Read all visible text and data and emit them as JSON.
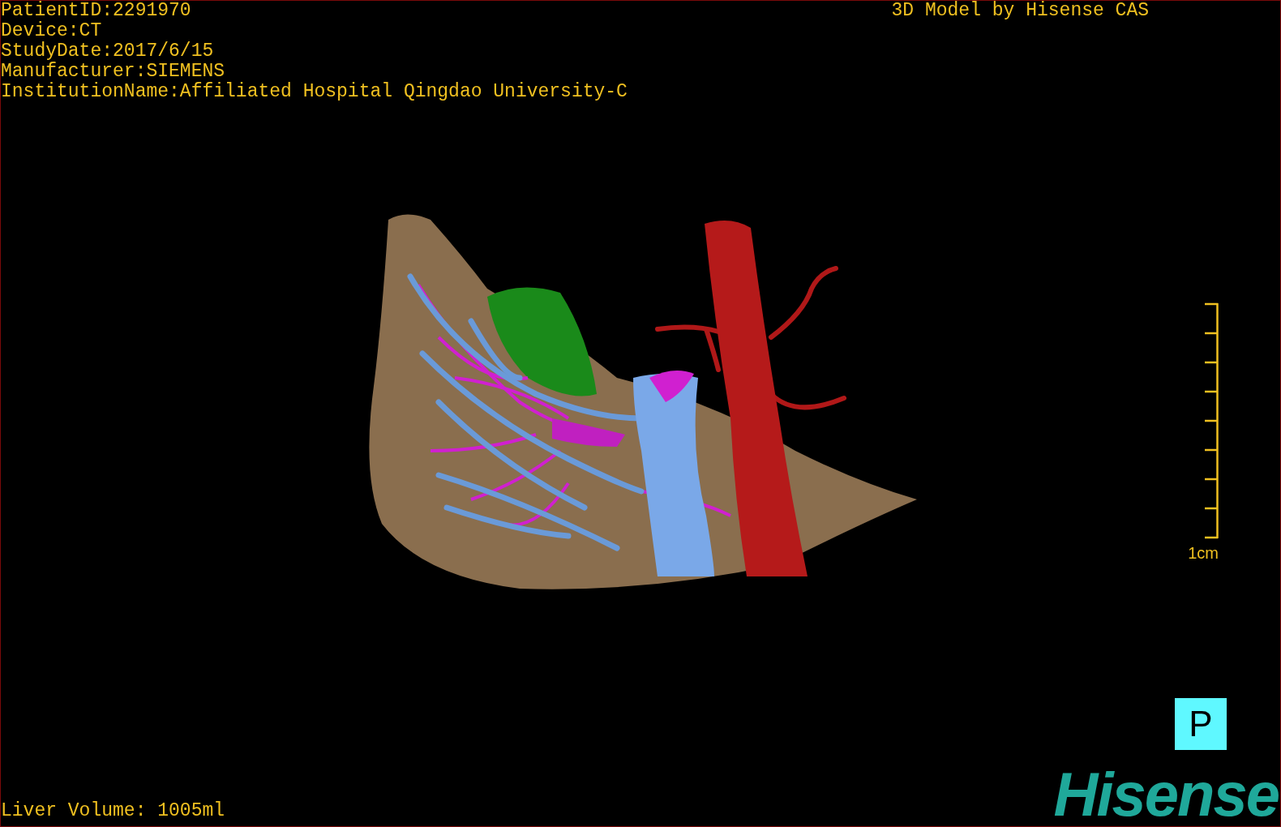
{
  "study_info": [
    "PatientID:2291970",
    "Device:CT",
    "StudyDate:2017/6/15",
    "Manufacturer:SIEMENS",
    "InstitutionName:Affiliated Hospital Qingdao University-C"
  ],
  "model_credit": "3D Model by Hisense CAS",
  "scale_bar": {
    "label": "1cm"
  },
  "liver_volume": "Liver Volume: 1005ml",
  "orientation_marker": "P",
  "logo": "Hisense"
}
